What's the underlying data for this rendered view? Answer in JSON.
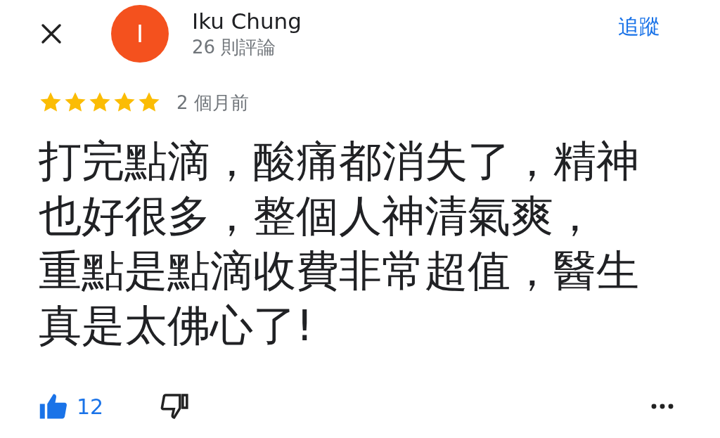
{
  "header": {
    "avatar_letter": "I",
    "name": "Iku Chung",
    "review_count": "26 則評論",
    "follow": "追蹤"
  },
  "review": {
    "stars": 5,
    "time": "2 個月前",
    "text_lines": [
      "打完點滴，酸痛都消失了，精神",
      "也好很多，整個人神清氣爽，",
      "重點是點滴收費非常超值，醫生",
      "真是太佛心了!"
    ]
  },
  "actions": {
    "likes": "12",
    "liked": true
  }
}
